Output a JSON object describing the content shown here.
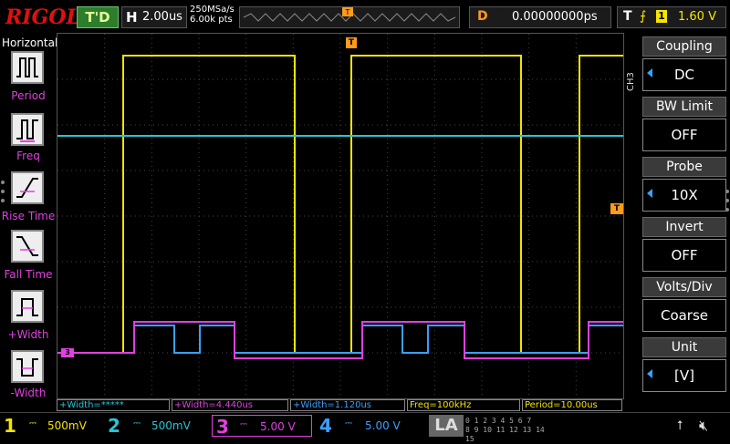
{
  "brand": "RIGOL",
  "topbar": {
    "status": "T'D",
    "horizontal_label": "H",
    "timebase": "2.00us",
    "sample_rate": "250MSa/s",
    "memory_depth": "6.00k pts",
    "delay_label": "D",
    "delay_value": "0.00000000ps",
    "trigger_label": "T",
    "trigger_source": "1",
    "trigger_level": "1.60 V"
  },
  "left_menu": {
    "title": "Horizontal",
    "items": [
      {
        "label": "Period"
      },
      {
        "label": "Freq"
      },
      {
        "label": "Rise Time"
      },
      {
        "label": "Fall Time"
      },
      {
        "label": "+Width"
      },
      {
        "label": "-Width"
      }
    ]
  },
  "right_menu": {
    "channel_tab": "CH3",
    "items": [
      {
        "title": "Coupling",
        "value": "DC"
      },
      {
        "title": "BW Limit",
        "value": "OFF"
      },
      {
        "title": "Probe",
        "value": "10X"
      },
      {
        "title": "Invert",
        "value": "OFF"
      },
      {
        "title": "Volts/Div",
        "value": "Coarse"
      },
      {
        "title": "Unit",
        "value": "[V]"
      }
    ]
  },
  "screen_markers": {
    "trigger_pos": "T",
    "ch3_marker": "3",
    "trigger_level_marker": "T"
  },
  "measurements": [
    {
      "text": "+Width=*****",
      "color": "#27c6d6"
    },
    {
      "text": "+Width=4.440us",
      "color": "#e040e0"
    },
    {
      "text": "+Width=1.120us",
      "color": "#39a0ff"
    },
    {
      "text": "Freq=100kHz",
      "color": "#f5e400"
    },
    {
      "text": "Period=10.00us",
      "color": "#f5e400"
    }
  ],
  "channels": [
    {
      "num": "1",
      "scale": "500mV",
      "color": "#f5e400"
    },
    {
      "num": "2",
      "scale": "500mV",
      "color": "#27c6d6"
    },
    {
      "num": "3",
      "scale": "5.00 V",
      "color": "#e040e0"
    },
    {
      "num": "4",
      "scale": "5.00 V",
      "color": "#39a0ff"
    }
  ],
  "la_label": "LA",
  "la_bits_top": "0 1 2 3 4 5 6 7",
  "la_bits_bottom": "8 9 10 11 12 13 14 15",
  "colors": {
    "ch1": "#f5e400",
    "ch2": "#27c6d6",
    "ch3": "#e040e0",
    "ch4": "#39a0ff",
    "accent_orange": "#ff9a1a",
    "status_green": "#2c7d2c",
    "brand_red": "#e01010"
  }
}
